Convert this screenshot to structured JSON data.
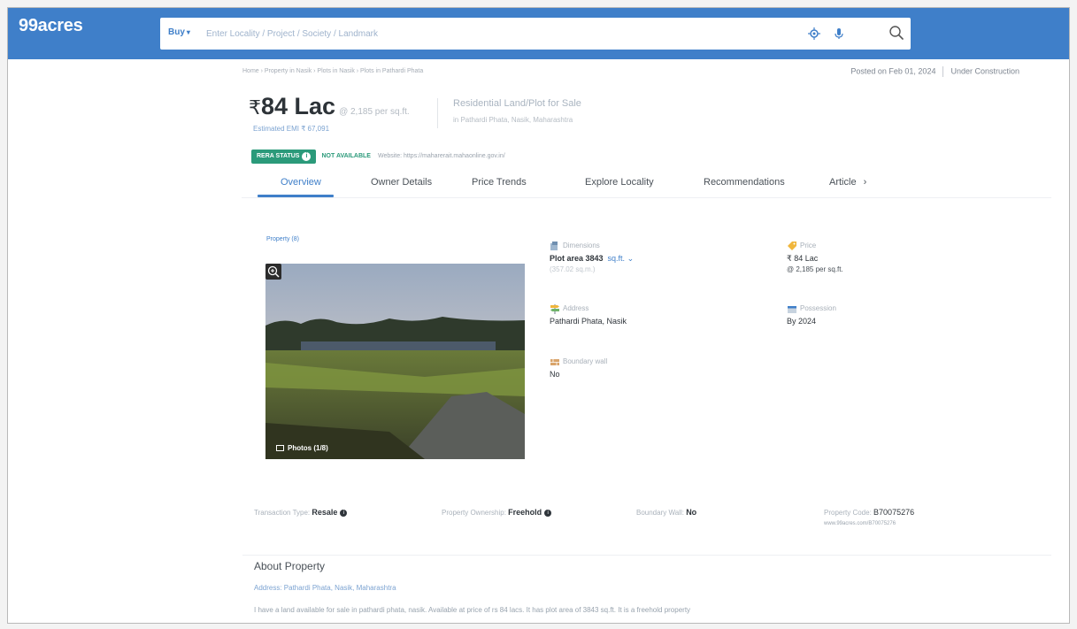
{
  "header": {
    "logo": "99acres",
    "buy_label": "Buy",
    "search_placeholder": "Enter Locality / Project / Society / Landmark"
  },
  "breadcrumb": "Home › Property in Nasik › Plots in Nasik › Plots in Pathardi Phata",
  "posted": {
    "date": "Posted on Feb 01, 2024",
    "status": "Under Construction"
  },
  "listing": {
    "currency": "₹",
    "price": "84 Lac",
    "rate": "@ 2,185 per sq.ft.",
    "emi": "Estimated EMI ₹ 67,091",
    "type": "Residential Land/Plot for Sale",
    "location": "in Pathardi Phata, Nasik, Maharashtra"
  },
  "rera": {
    "badge": "RERA STATUS",
    "status": "NOT AVAILABLE",
    "website": "Website: https://maharerait.mahaonline.gov.in/"
  },
  "tabs": [
    {
      "label": "Overview",
      "active": true
    },
    {
      "label": "Owner Details"
    },
    {
      "label": "Price Trends"
    },
    {
      "label": "Explore Locality"
    },
    {
      "label": "Recommendations"
    },
    {
      "label": "Article"
    }
  ],
  "property": {
    "count_label": "Property (8)",
    "photos_label": "Photos (1/8)"
  },
  "attributes": {
    "dimensions": {
      "label": "Dimensions",
      "value": "Plot area 3843",
      "unit": "sq.ft.",
      "sub": "(357.02 sq.m.)"
    },
    "price": {
      "label": "Price",
      "value": "₹ 84 Lac",
      "sub": "@ 2,185 per sq.ft."
    },
    "address": {
      "label": "Address",
      "value": "Pathardi Phata, Nasik"
    },
    "possession": {
      "label": "Possession",
      "value": "By 2024"
    },
    "boundary": {
      "label": "Boundary wall",
      "value": "No"
    }
  },
  "summary": {
    "transaction_label": "Transaction Type:",
    "transaction_value": "Resale",
    "ownership_label": "Property Ownership:",
    "ownership_value": "Freehold",
    "boundary_label": "Boundary Wall:",
    "boundary_value": "No",
    "code_label": "Property Code:",
    "code_value": "B70075276",
    "code_url": "www.99acres.com/B70075276"
  },
  "about": {
    "title": "About Property",
    "address": "Address: Pathardi Phata, Nasik, Maharashtra",
    "description": "I have a land available for sale in pathardi phata, nasik. Available at price of rs 84 lacs. It has plot area of 3843 sq.ft. It is a freehold property"
  },
  "colors": {
    "brand_blue": "#3f7fc9",
    "rera_green": "#2b9a7a"
  }
}
